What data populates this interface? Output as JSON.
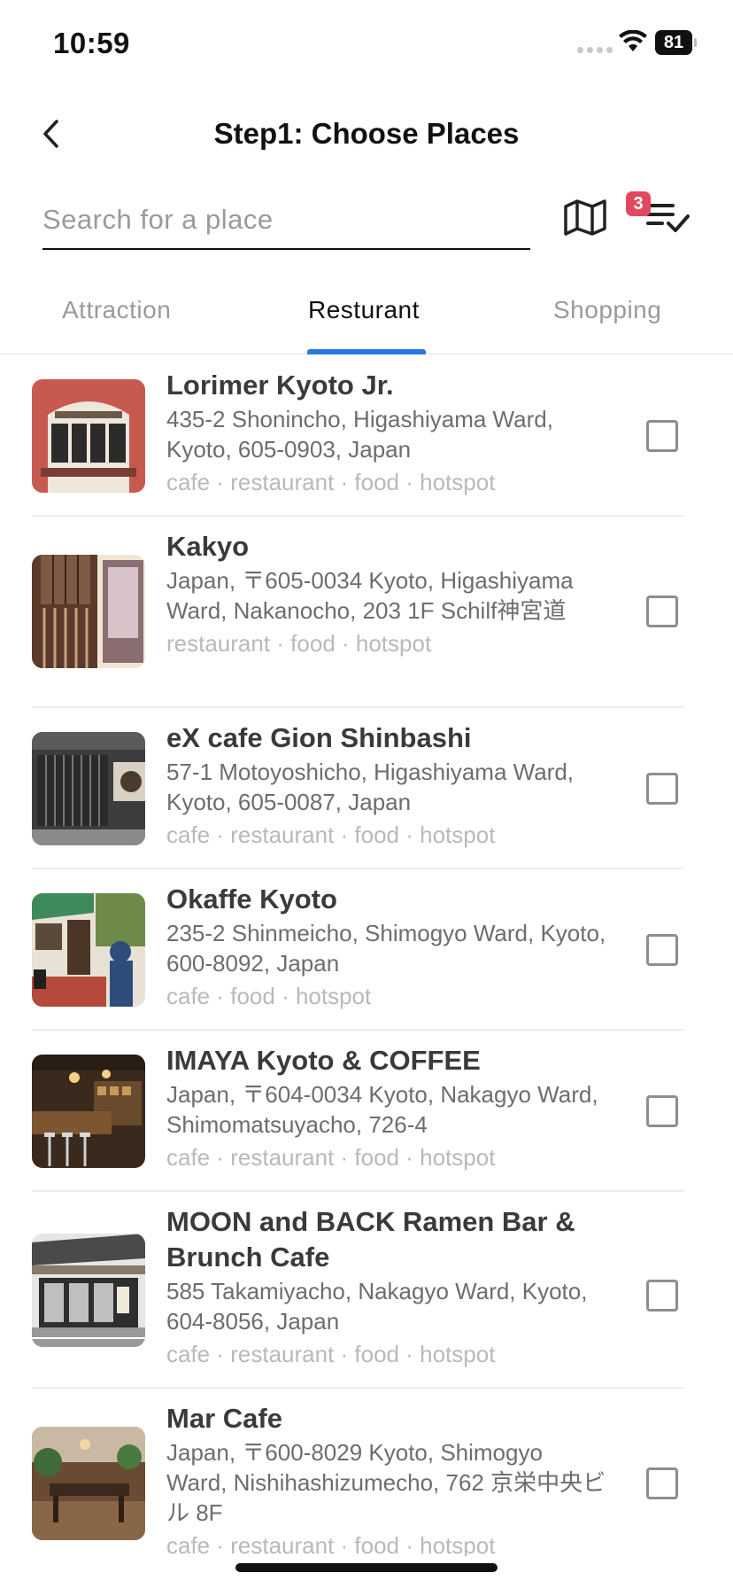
{
  "status_bar": {
    "time": "10:59",
    "battery": "81"
  },
  "header": {
    "title": "Step1: Choose Places",
    "back_icon": "chevron-left-icon"
  },
  "search": {
    "placeholder": "Search for a place",
    "value": ""
  },
  "toolbar": {
    "map_icon": "map-icon",
    "list_icon": "list-check-icon",
    "selected_count": "3"
  },
  "tabs": [
    {
      "label": "Attraction",
      "active": false
    },
    {
      "label": "Resturant",
      "active": true
    },
    {
      "label": "Shopping",
      "active": false
    }
  ],
  "colors": {
    "accent": "#2a79e6",
    "badge": "#e0485d"
  },
  "places": [
    {
      "name": "Lorimer Kyoto Jr.",
      "address": "435-2 Shonincho, Higashiyama Ward, Kyoto, 605-0903, Japan",
      "tags": "cafe · restaurant · food · hotspot",
      "checked": false
    },
    {
      "name": "Kakyo",
      "address": "Japan, 〒605-0034 Kyoto, Higashiyama Ward, Nakanocho, 203 1F Schilf神宮道",
      "tags": "restaurant · food · hotspot",
      "checked": false
    },
    {
      "name": "eX cafe Gion Shinbashi",
      "address": "57-1 Motoyoshicho, Higashiyama Ward, Kyoto, 605-0087, Japan",
      "tags": "cafe · restaurant · food · hotspot",
      "checked": false
    },
    {
      "name": "Okaffe Kyoto",
      "address": "235-2 Shinmeicho, Shimogyo Ward, Kyoto, 600-8092, Japan",
      "tags": "cafe · food · hotspot",
      "checked": false
    },
    {
      "name": "IMAYA Kyoto & COFFEE",
      "address": "Japan, 〒604-0034 Kyoto, Nakagyo Ward, Shimomatsuyacho, 726-4",
      "tags": "cafe · restaurant · food · hotspot",
      "checked": false
    },
    {
      "name": "MOON and BACK Ramen Bar & Brunch Cafe",
      "address": "585 Takamiyacho, Nakagyo Ward, Kyoto, 604-8056, Japan",
      "tags": "cafe · restaurant · food · hotspot",
      "checked": false
    },
    {
      "name": "Mar Cafe",
      "address": "Japan, 〒600-8029 Kyoto, Shimogyo Ward, Nishihashizumecho, 762 京栄中央ビル 8F",
      "tags": "cafe · restaurant · food · hotspot",
      "checked": false
    }
  ]
}
